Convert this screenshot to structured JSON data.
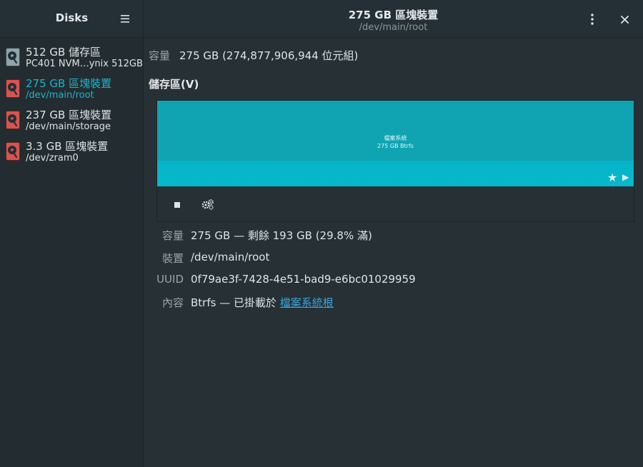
{
  "header": {
    "app_title": "Disks",
    "title": "275 GB 區塊裝置",
    "subtitle": "/dev/main/root"
  },
  "sidebar": {
    "items": [
      {
        "title": "512 GB 儲存區",
        "subtitle": "PC401 NVM…ynix 512GB",
        "icon": "disk-icon",
        "selected": false
      },
      {
        "title": "275 GB 區塊裝置",
        "subtitle": "/dev/main/root",
        "icon": "block-device-icon",
        "selected": true
      },
      {
        "title": "237 GB 區塊裝置",
        "subtitle": "/dev/main/storage",
        "icon": "block-device-icon",
        "selected": false
      },
      {
        "title": "3.3 GB 區塊裝置",
        "subtitle": "/dev/zram0",
        "icon": "block-device-icon",
        "selected": false
      }
    ]
  },
  "main": {
    "capacity": {
      "label": "容量",
      "value": "275 GB (274,877,906,944 位元組)"
    },
    "volumes_heading": "儲存區(V)",
    "volume": {
      "line1": "檔案系統",
      "line2": "275 GB Btrfs",
      "color": "#10a4b3"
    },
    "properties": [
      {
        "label": "容量",
        "value": "275 GB — 剩餘 193 GB (29.8% 滿)"
      },
      {
        "label": "裝置",
        "value": "/dev/main/root"
      },
      {
        "label": "UUID",
        "value": "0f79ae3f-7428-4e51-bad9-e6bc01029959"
      },
      {
        "label": "內容",
        "value": "Btrfs — 已掛載於 ",
        "link": "檔案系統根"
      }
    ]
  },
  "colors": {
    "accent": "#1cb5c9",
    "link": "#3aa4dd",
    "background": "#263035",
    "sidebar": "#232c31"
  }
}
